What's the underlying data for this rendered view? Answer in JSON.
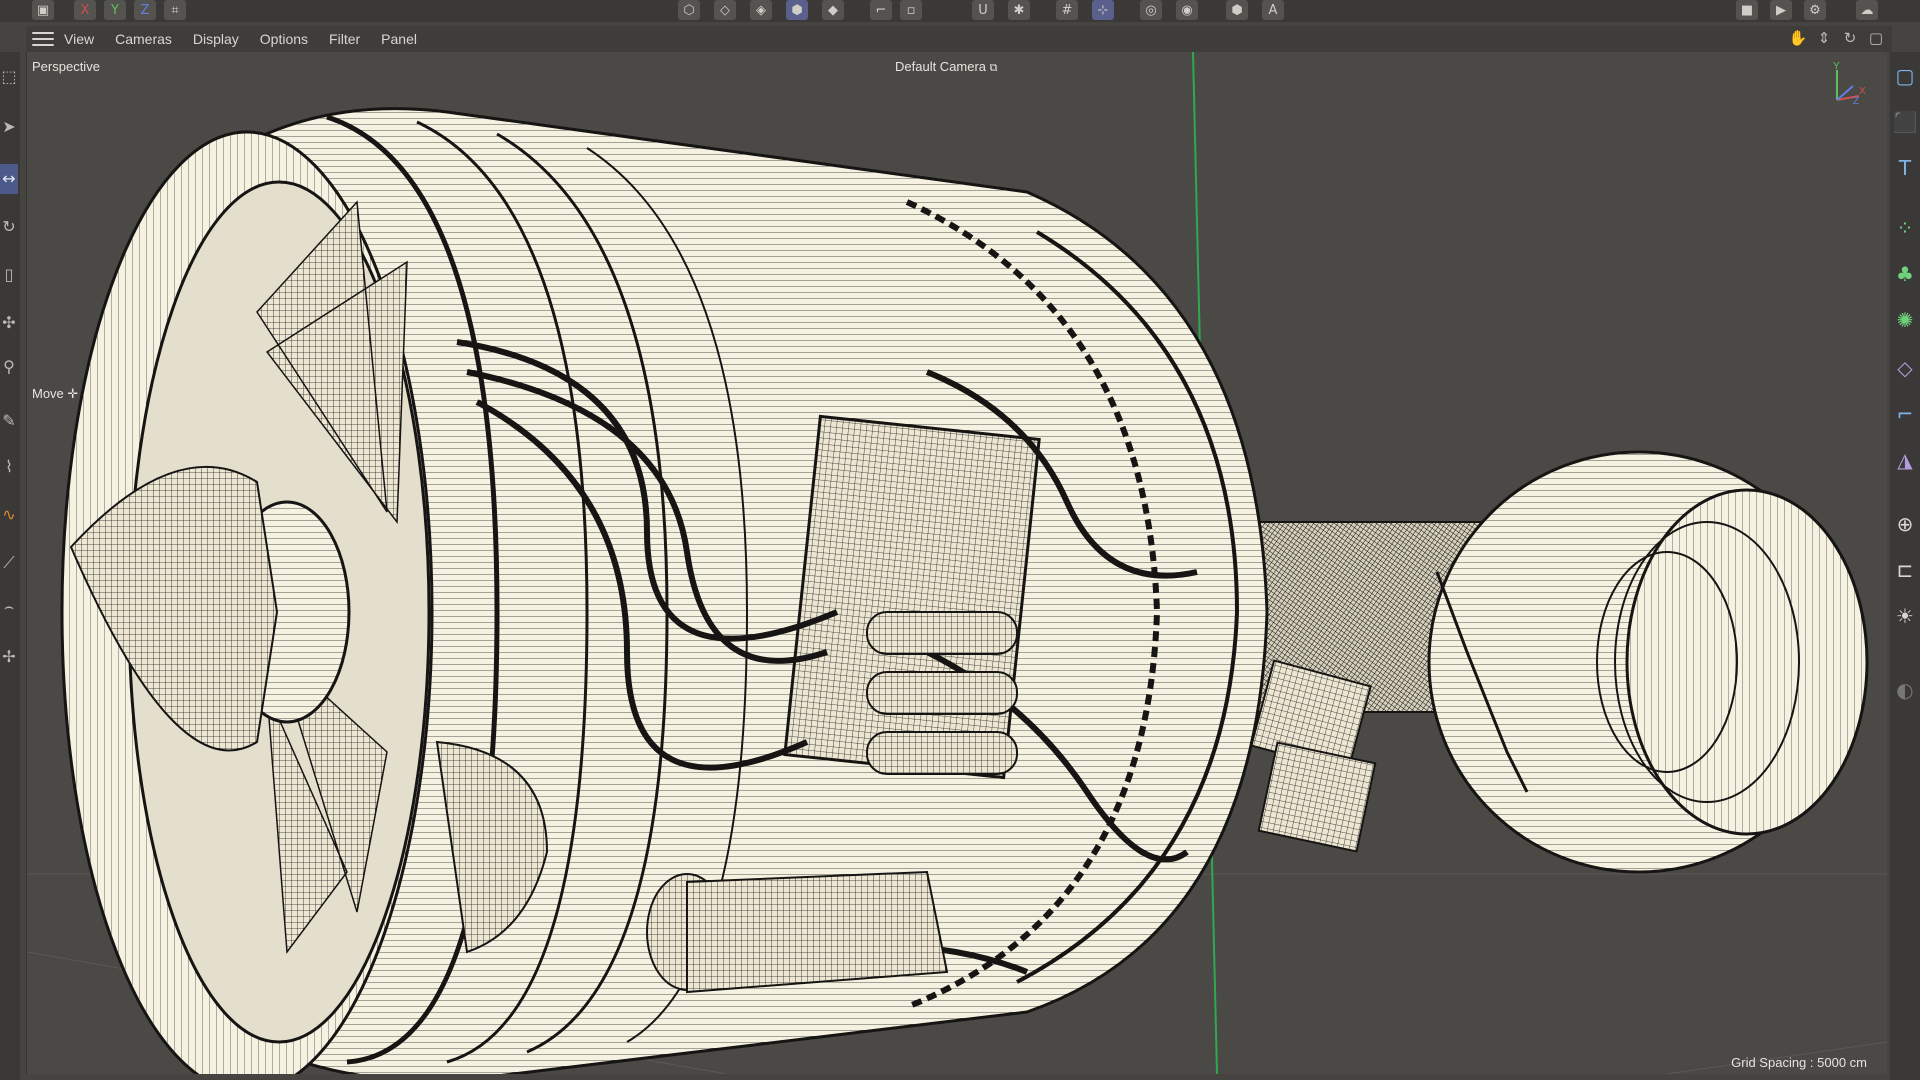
{
  "menu": {
    "items": [
      "View",
      "Cameras",
      "Display",
      "Options",
      "Filter",
      "Panel"
    ]
  },
  "viewport": {
    "view_name": "Perspective",
    "camera_name": "Default Camera",
    "camera_icon": "camera-link-icon",
    "tool_label": "Move",
    "tool_icon": "move-cross-icon",
    "grid_spacing": "Grid Spacing : 5000 cm",
    "axis_gizmo": {
      "y": "Y",
      "x": "X",
      "z": "Z"
    },
    "wireframe_color": "#f6f2e2",
    "wire_line_color": "#1d1c1a",
    "background_color": "#4a4946",
    "horizon_line_color": "#2fa84f"
  },
  "top_toolbar": {
    "icons": [
      "render-region-icon",
      "x-axis-lock-icon",
      "y-axis-lock-icon",
      "z-axis-lock-icon",
      "coordinate-system-icon",
      "cube-points-icon",
      "edges-mode-icon",
      "polygons-mode-icon",
      "model-mode-icon",
      "uv-mode-icon",
      "axis-mode-icon",
      "snap-icon",
      "snap-settings-icon",
      "workplane-icon",
      "quantize-icon",
      "render-icon",
      "render-settings-icon",
      "material-icon",
      "texture-icon",
      "render-view-icon",
      "render-picture-viewer-icon",
      "edit-render-settings-icon",
      "shared-icon"
    ],
    "active_icons": [
      "polygons-mode-icon",
      "quantize-icon"
    ]
  },
  "nav_icons": [
    "pan-hand-icon",
    "dolly-arrows-icon",
    "orbit-icon",
    "maximize-view-icon"
  ],
  "left_tools": [
    "live-selection-icon",
    "move-select-icon",
    "move-tool-icon",
    "rotate-tool-icon",
    "scale-tool-icon",
    "transform-icon",
    "snap-tool-icon",
    "pen-tool-icon",
    "brush-icon",
    "spline-icon",
    "knife-icon",
    "paint-icon",
    "sculpt-icon"
  ],
  "right_tools": [
    "rectangle-icon",
    "cube-icon",
    "text-icon",
    "mograph-cloner-icon",
    "generator-icon",
    "deformer-icon",
    "environment-icon",
    "camera-icon",
    "light-bulb-icon",
    "sphere-grid-icon",
    "null-icon",
    "lamp-icon",
    "material-preview-icon"
  ]
}
